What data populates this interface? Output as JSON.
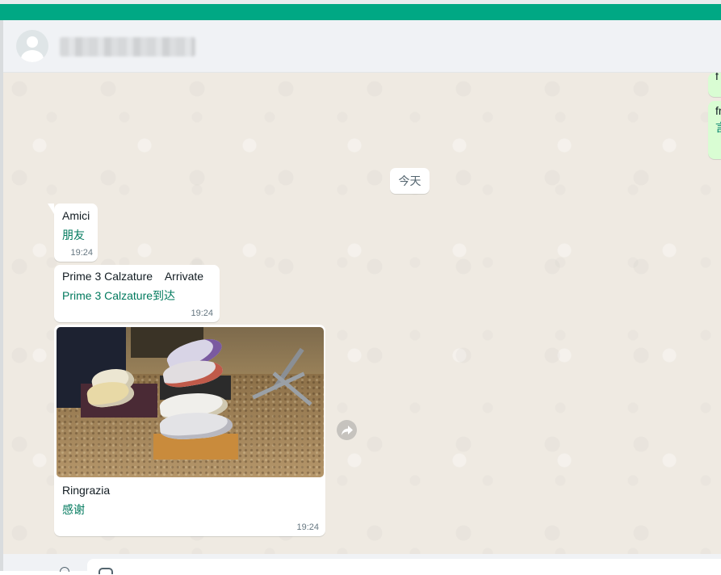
{
  "colors": {
    "accent_bar": "#00a884",
    "chat_background": "#efeae2",
    "incoming_bubble": "#ffffff",
    "outgoing_bubble": "#d9fdd3",
    "translation_text": "#027a5e"
  },
  "header": {
    "contact_name": "███████████",
    "avatar_icon": "default-user-avatar-icon"
  },
  "outgoing_fragments": [
    {
      "line1": "f",
      "line2": ""
    },
    {
      "line1": "fr",
      "line2": "言"
    }
  ],
  "date_divider": "今天",
  "messages": [
    {
      "text": "Amici",
      "translation": "朋友",
      "time": "19:24"
    },
    {
      "text": "Prime 3 Calzature    Arrivate",
      "translation": "Prime 3 Calzature到达",
      "time": "19:24"
    },
    {
      "text": "Ringrazia",
      "translation": "感谢",
      "time": "19:24",
      "image_icon": "shoes-photo"
    }
  ],
  "forward_icon": "forward-icon",
  "composer": {
    "emoji_icon": "emoji-icon",
    "attach_icon": "attach-icon"
  }
}
